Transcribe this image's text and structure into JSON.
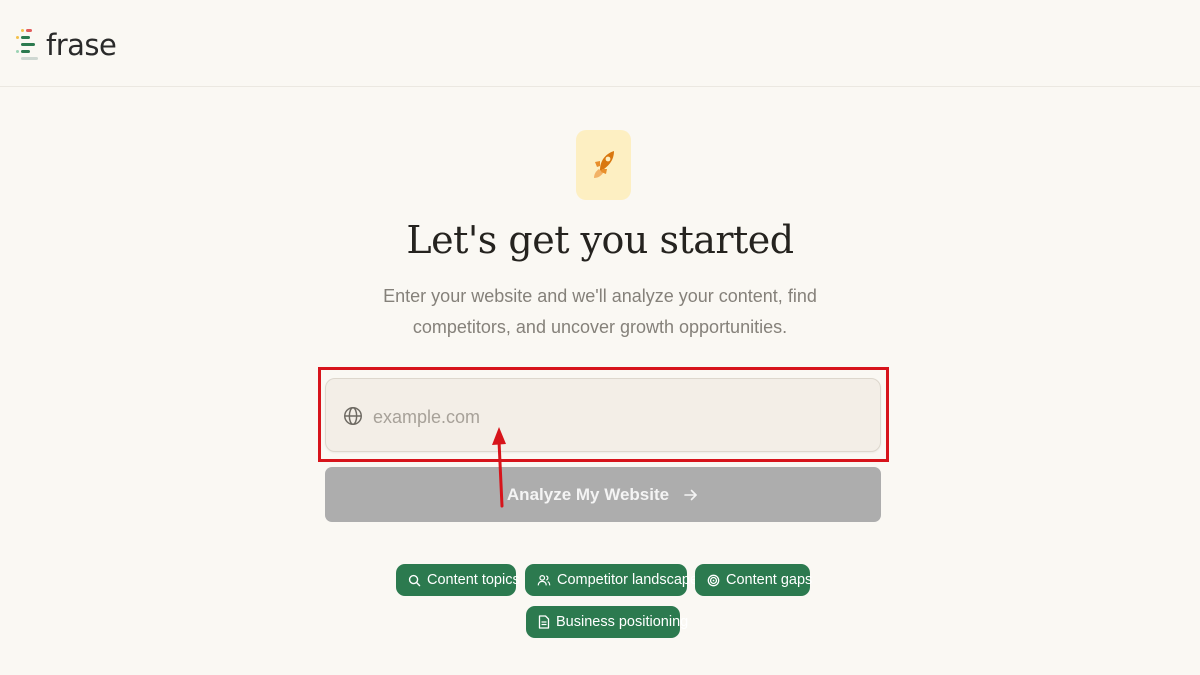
{
  "header": {
    "logo_text": "frase"
  },
  "hero": {
    "icon": "rocket-icon",
    "icon_bg": "#fdefc2",
    "title": "Let's get you started",
    "subtitle": "Enter your website and we'll analyze your content, find competitors, and uncover growth opportunities."
  },
  "form": {
    "url_placeholder": "example.com",
    "url_value": "",
    "input_icon": "globe-icon",
    "analyze_label": "Analyze My Website",
    "analyze_icon": "arrow-right-icon"
  },
  "chips": [
    {
      "label": "Content topics",
      "icon": "search-icon"
    },
    {
      "label": "Competitor landscape",
      "icon": "users-icon"
    },
    {
      "label": "Content gaps",
      "icon": "target-icon"
    },
    {
      "label": "Business positioning",
      "icon": "document-icon"
    }
  ],
  "colors": {
    "background": "#faf8f3",
    "chip_green": "#2c7a4f",
    "button_disabled": "#adadad",
    "highlight_red": "#d7141b",
    "rocket_orange": "#d9770f"
  }
}
